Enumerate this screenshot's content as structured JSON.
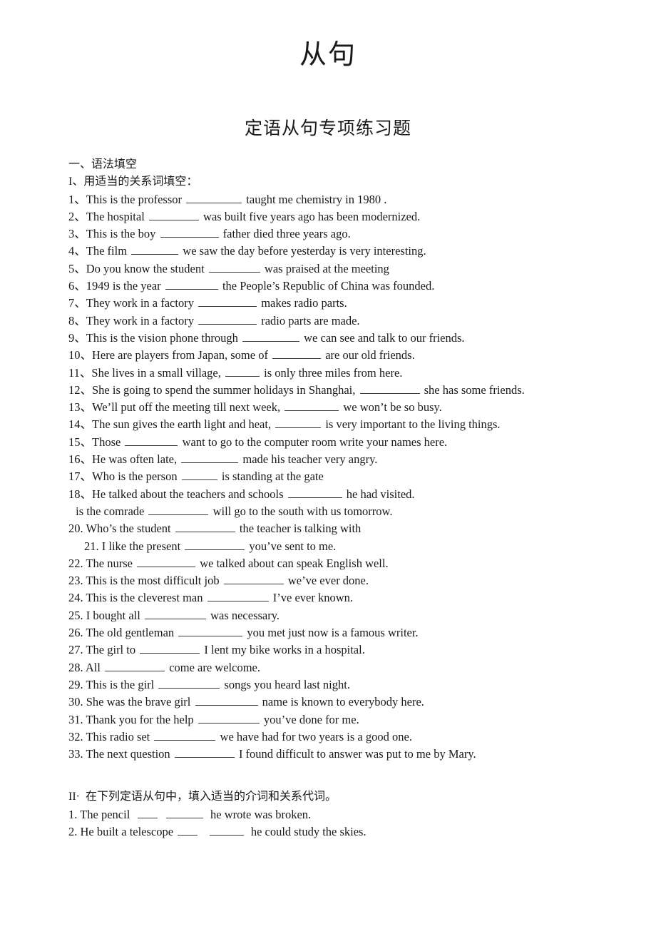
{
  "document": {
    "title": "从句",
    "section_title": "定语从句专项练习题",
    "part1_heading": "一、语法填空",
    "part1_subheading": "I、用适当的关系词填空：",
    "part1_items": [
      {
        "num": "1、",
        "pre": "This is the professor ",
        "blank": 78,
        "post": " taught me chemistry in 1980 ."
      },
      {
        "num": "2、",
        "pre": "The hospital ",
        "blank": 70,
        "post": " was built five years ago has been modernized."
      },
      {
        "num": "3、",
        "pre": "This is the boy ",
        "blank": 82,
        "post": " father died three years ago."
      },
      {
        "num": "4、",
        "pre": "The film ",
        "blank": 66,
        "post": " we saw the day before yesterday is very interesting."
      },
      {
        "num": "5、",
        "pre": "Do you know the student ",
        "blank": 72,
        "post": " was praised at the meeting"
      },
      {
        "num": "6、",
        "pre": "1949 is the year ",
        "blank": 74,
        "post": " the People’s Republic of China was founded."
      },
      {
        "num": "7、",
        "pre": "They work in a factory ",
        "blank": 82,
        "post": " makes radio parts."
      },
      {
        "num": "8、",
        "pre": "They work in a factory ",
        "blank": 82,
        "post": " radio parts are made."
      },
      {
        "num": "9、",
        "pre": "This is the vision phone through ",
        "blank": 80,
        "post": " we can see and talk to our friends."
      },
      {
        "num": "10、",
        "pre": "Here are players from Japan, some of ",
        "blank": 68,
        "post": " are our old friends."
      },
      {
        "num": "11、",
        "pre": "She lives in a small village, ",
        "blank": 48,
        "post": " is only three miles from here."
      },
      {
        "num": "12、",
        "pre": "She is going to spend the summer holidays in Shanghai, ",
        "blank": 84,
        "post": " she has some friends."
      },
      {
        "num": "13、",
        "pre": "We’ll put off the meeting till next week, ",
        "blank": 76,
        "post": " we won’t be so busy."
      },
      {
        "num": "14、",
        "pre": "The sun gives the earth light and heat, ",
        "blank": 64,
        "post": " is very important to the living things."
      },
      {
        "num": "15、",
        "pre": "Those ",
        "blank": 74,
        "post": " want to go to the computer room write your names here."
      },
      {
        "num": "16、",
        "pre": "He was often late, ",
        "blank": 80,
        "post": " made his teacher very angry."
      },
      {
        "num": "17、",
        "pre": "Who is the person ",
        "blank": 50,
        "post": " is standing at the gate"
      },
      {
        "num": "18、",
        "pre": "He talked about the teachers and schools ",
        "blank": 76,
        "post": " he had visited."
      },
      {
        "num": "",
        "pre": " is the comrade ",
        "blank": 84,
        "post": " will go to the south with us tomorrow.",
        "indent": 1
      },
      {
        "num": "20.",
        "pre": " Who’s the student ",
        "blank": 84,
        "post": " the teacher is talking with"
      },
      {
        "num": "21.",
        "pre": " I like the present ",
        "blank": 84,
        "post": " you’ve sent to me.",
        "indent": 2
      },
      {
        "num": "22.",
        "pre": " The nurse ",
        "blank": 82,
        "post": " we talked about can speak English well."
      },
      {
        "num": "23.",
        "pre": " This is the most difficult job ",
        "blank": 84,
        "post": " we’ve ever done."
      },
      {
        "num": "24.",
        "pre": " This is the cleverest man ",
        "blank": 86,
        "post": " I’ve ever known."
      },
      {
        "num": "25.",
        "pre": " I bought all ",
        "blank": 86,
        "post": " was necessary."
      },
      {
        "num": "26.",
        "pre": " The old gentleman ",
        "blank": 90,
        "post": " you met just now is a famous writer."
      },
      {
        "num": "27.",
        "pre": " The girl to ",
        "blank": 84,
        "post": " I lent my bike works in a hospital."
      },
      {
        "num": "28.",
        "pre": " All ",
        "blank": 84,
        "post": " come are welcome."
      },
      {
        "num": "29.",
        "pre": " This is the girl ",
        "blank": 86,
        "post": " songs you heard last night."
      },
      {
        "num": "30.",
        "pre": " She was the brave girl ",
        "blank": 88,
        "post": " name is known to everybody here."
      },
      {
        "num": "31.",
        "pre": " Thank you for the help ",
        "blank": 86,
        "post": " you’ve done for me."
      },
      {
        "num": "32.",
        "pre": " This radio set ",
        "blank": 86,
        "post": " we have had for two years is a good one."
      },
      {
        "num": "33.",
        "pre": " The next question ",
        "blank": 84,
        "post": " I found difficult to answer was put to me by Mary."
      }
    ],
    "part2_heading": "II·  在下列定语从句中，填入适当的介词和关系代词。",
    "part2_items": [
      {
        "num": "1.",
        "pre": " The pencil  ",
        "blank1": 28,
        "mid": "  ",
        "blank2": 52,
        "post": "  he wrote was broken."
      },
      {
        "num": "2.",
        "pre": " He built a telescope ",
        "blank1": 28,
        "mid": "   ",
        "blank2": 48,
        "post": "  he could study the skies."
      }
    ]
  }
}
